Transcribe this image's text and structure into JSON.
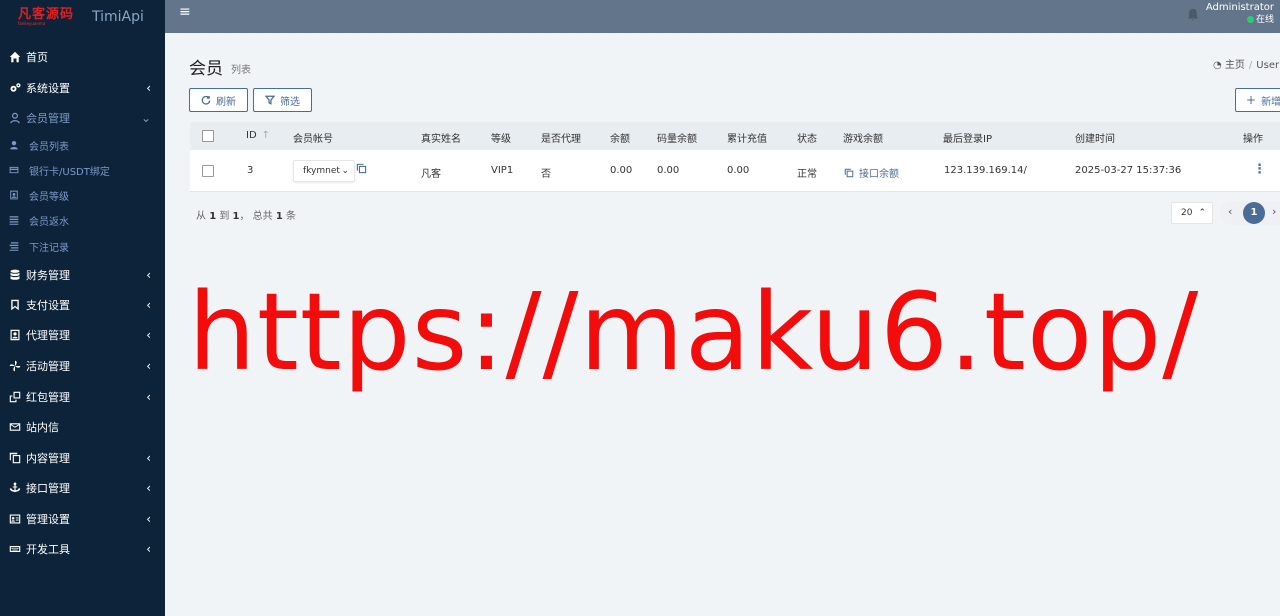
{
  "app": {
    "logo_text": "凡客源码",
    "logo_subtext": "fankeyuanma",
    "name": "TimiApi"
  },
  "header": {
    "menu_icon": "hamburger-icon",
    "user_name": "Administrator",
    "status": "在线",
    "status_color": "#2ecc71"
  },
  "sidebar": {
    "items": [
      {
        "label": "首页",
        "icon": "home-icon"
      },
      {
        "label": "系统设置",
        "icon": "gears-icon"
      },
      {
        "label": "会员管理",
        "icon": "user-icon"
      },
      {
        "label": "财务管理",
        "icon": "database-icon"
      },
      {
        "label": "支付设置",
        "icon": "bookmark-icon"
      },
      {
        "label": "代理管理",
        "icon": "id-card-icon"
      },
      {
        "label": "活动管理",
        "icon": "pinwheel-icon"
      },
      {
        "label": "红包管理",
        "icon": "clone-icon"
      },
      {
        "label": "站内信",
        "icon": "envelope-icon"
      },
      {
        "label": "内容管理",
        "icon": "copy-icon"
      },
      {
        "label": "接口管理",
        "icon": "anchor-icon"
      },
      {
        "label": "管理设置",
        "icon": "address-card-icon"
      },
      {
        "label": "开发工具",
        "icon": "keyboard-icon"
      }
    ],
    "subitems": [
      {
        "label": "会员列表",
        "icon": "user-small-icon"
      },
      {
        "label": "银行卡/USDT绑定",
        "icon": "credit-card-icon"
      },
      {
        "label": "会员等级",
        "icon": "portrait-icon"
      },
      {
        "label": "会员返水",
        "icon": "list-icon"
      },
      {
        "label": "下注记录",
        "icon": "list-alt-icon"
      }
    ]
  },
  "page": {
    "title": "会员",
    "subtitle": "列表",
    "breadcrumb_home": "主页",
    "breadcrumb_current": "User"
  },
  "toolbar": {
    "refresh_label": "刷新",
    "filter_label": "筛选",
    "add_label": "新增"
  },
  "table": {
    "columns": [
      "ID",
      "会员帐号",
      "真实姓名",
      "等级",
      "是否代理",
      "余额",
      "码量余额",
      "累计充值",
      "状态",
      "游戏余额",
      "最后登录IP",
      "创建时间",
      "操作"
    ],
    "rows": [
      {
        "id": "3",
        "account": "fkymnet",
        "real_name": "凡客",
        "level": "VIP1",
        "is_agent": "否",
        "balance": "0.00",
        "code_balance": "0.00",
        "total_recharge": "0.00",
        "status": "正常",
        "game_balance": "接口余额",
        "last_ip": "123.139.169.14/",
        "created_at": "2025-03-27 15:37:36"
      }
    ]
  },
  "pagination": {
    "summary_prefix": "从",
    "from": "1",
    "to_word": "到",
    "to": "1",
    "total_word": "， 总共",
    "total": "1",
    "unit": "条",
    "page_size": "20",
    "current_page": "1"
  },
  "watermark": "https://maku6.top/",
  "colors": {
    "sidebar_bg": "#0d2339",
    "header_bg": "#63758a",
    "accent": "#4b6b98",
    "watermark": "#f20c0c"
  }
}
